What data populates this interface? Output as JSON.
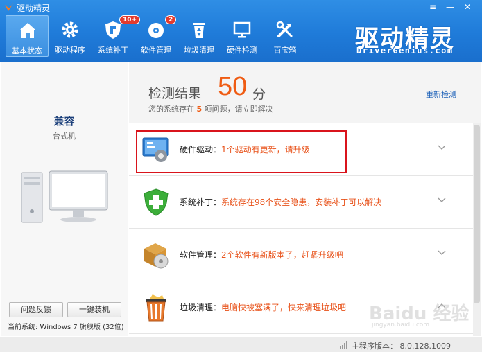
{
  "window": {
    "title": "驱动精灵",
    "menu_glyph": "≡",
    "minimize_glyph": "—",
    "close_glyph": "✕"
  },
  "nav": [
    {
      "label": "基本状态",
      "icon": "home-icon",
      "active": true
    },
    {
      "label": "驱动程序",
      "icon": "gear-icon"
    },
    {
      "label": "系统补丁",
      "icon": "shield-icon",
      "badge": "10+"
    },
    {
      "label": "软件管理",
      "icon": "disc-icon",
      "badge": "2"
    },
    {
      "label": "垃圾清理",
      "icon": "recycle-bin-icon"
    },
    {
      "label": "硬件检测",
      "icon": "monitor-icon"
    },
    {
      "label": "百宝箱",
      "icon": "tools-icon"
    }
  ],
  "brand": {
    "name": "驱动精灵",
    "url_text": "DriverGenius.com"
  },
  "left": {
    "compat": "兼容",
    "pc_type": "台式机",
    "feedback_label": "问题反馈",
    "install_label": "一键装机",
    "system_info": "当前系统:  Windows 7 旗舰版 (32位)"
  },
  "result": {
    "label": "检测结果",
    "score": "50",
    "unit": "分",
    "desc_prefix": "您的系统存在",
    "desc_count": "5",
    "desc_suffix": "项问题，请立即解决",
    "recheck": "重新检测"
  },
  "items": [
    {
      "name": "硬件驱动：",
      "desc": "1个驱动有更新，请升级",
      "icon": "hardware-driver-icon"
    },
    {
      "name": "系统补丁：",
      "desc": "系统存在98个安全隐患，安装补丁可以解决",
      "icon": "security-shield-plus-icon"
    },
    {
      "name": "软件管理：",
      "desc": "2个软件有新版本了，赶紧升级吧",
      "icon": "software-package-icon"
    },
    {
      "name": "垃圾清理：",
      "desc": "电脑快被塞满了，快来清理垃圾吧",
      "icon": "trash-bin-icon"
    }
  ],
  "status": {
    "version": "主程序版本： 8.0.128.1009"
  },
  "watermark": {
    "text": "Baidu 经验",
    "url": "jingyan.baidu.com"
  },
  "colors": {
    "toolbar": "#1f7bd9",
    "accent": "#ef5b12",
    "highlight": "#d9141c",
    "link": "#1a5fb8"
  }
}
